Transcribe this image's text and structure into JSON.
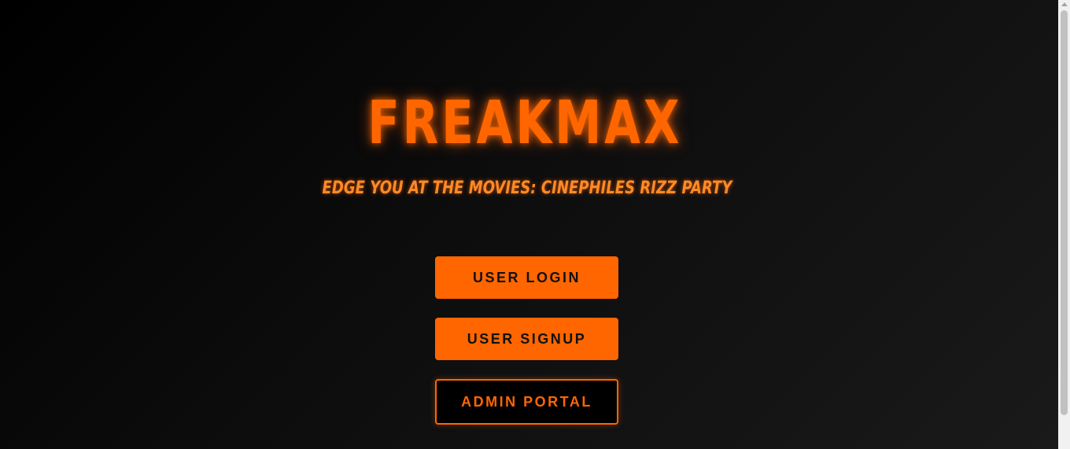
{
  "brand": {
    "title": "FREAKMAX",
    "tagline": "EDGE YOU AT THE MOVIES: CINEPHILES RIZZ PARTY"
  },
  "actions": {
    "user_login": "USER LOGIN",
    "user_signup": "USER SIGNUP",
    "admin_portal": "ADMIN PORTAL"
  },
  "colors": {
    "accent": "#ff6600",
    "background": "#0d0d0d",
    "button_text_dark": "#111111"
  }
}
